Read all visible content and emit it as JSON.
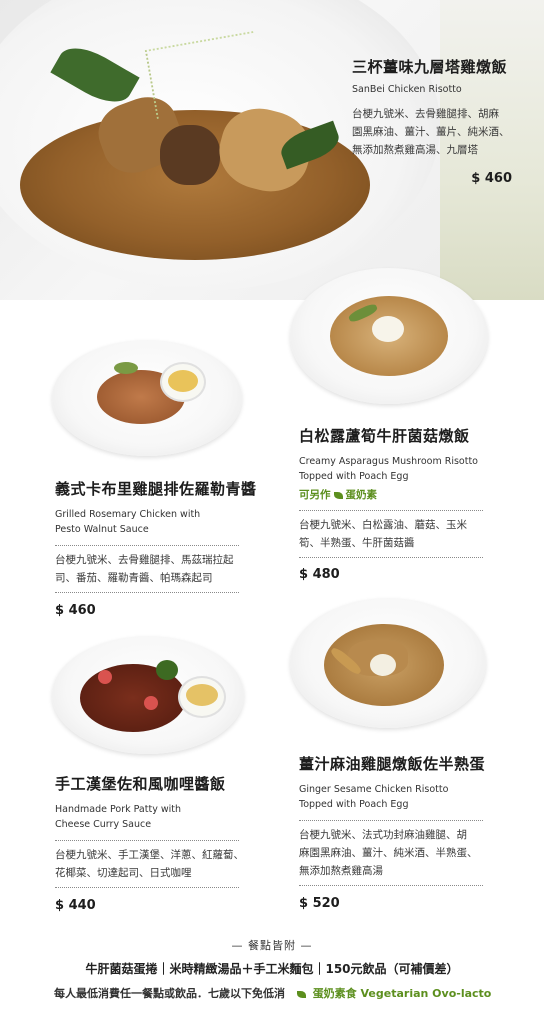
{
  "hero": {
    "name_zh": "三杯薑味九層塔雞燉飯",
    "name_en": "SanBei Chicken Risotto",
    "desc": [
      "台梗九號米、去骨雞腿排、胡麻",
      "園黑麻油、薑汁、薑片、純米酒、",
      "無添加熬煮雞高湯、九層塔"
    ],
    "price": "$ 460"
  },
  "dishes": [
    {
      "name_zh": "白松露蘆筍牛肝菌菇燉飯",
      "name_en": [
        "Creamy Asparagus Mushroom Risotto",
        "Topped with Poach Egg"
      ],
      "veg_note": "可另作",
      "veg_label": "蛋奶素",
      "desc": [
        "台梗九號米、白松露油、蘑菇、玉米",
        "筍、半熟蛋、牛肝菌菇醬"
      ],
      "price": "$ 480"
    },
    {
      "name_zh": "義式卡布里雞腿排佐羅勒青醬",
      "name_en": [
        "Grilled Rosemary Chicken with",
        "Pesto Walnut Sauce"
      ],
      "desc": [
        "台梗九號米、去骨雞腿排、馬茲瑞拉起",
        "司、番茄、羅勒青醬、帕瑪森起司"
      ],
      "price": "$ 460"
    },
    {
      "name_zh": "手工漢堡佐和風咖哩醬飯",
      "name_en": [
        "Handmade Pork Patty with",
        "Cheese Curry Sauce"
      ],
      "desc": [
        "台梗九號米、手工漢堡、洋蔥、紅蘿蔔、",
        "花椰菜、切達起司、日式咖哩"
      ],
      "price": "$ 440"
    },
    {
      "name_zh": "薑汁麻油雞腿燉飯佐半熟蛋",
      "name_en": [
        "Ginger Sesame Chicken Risotto",
        "Topped with Poach Egg"
      ],
      "desc": [
        "台梗九號米、法式功封麻油雞腿、胡",
        "麻園黑麻油、薑汁、純米酒、半熟蛋、",
        "無添加熬煮雞高湯"
      ],
      "price": "$ 520"
    }
  ],
  "footer": {
    "heading": "— 餐點皆附 —",
    "includes": "牛肝菌菇蛋捲｜米時精緻湯品＋手工米麵包｜150元飲品（可補價差）",
    "policy": "每人最低消費任一餐點或飲品．七歲以下免低消",
    "veg_legend": "蛋奶素食 Vegetarian Ovo-lacto"
  },
  "colors": {
    "veg_green": "#5c8f1e",
    "text": "#2b2b2b"
  }
}
